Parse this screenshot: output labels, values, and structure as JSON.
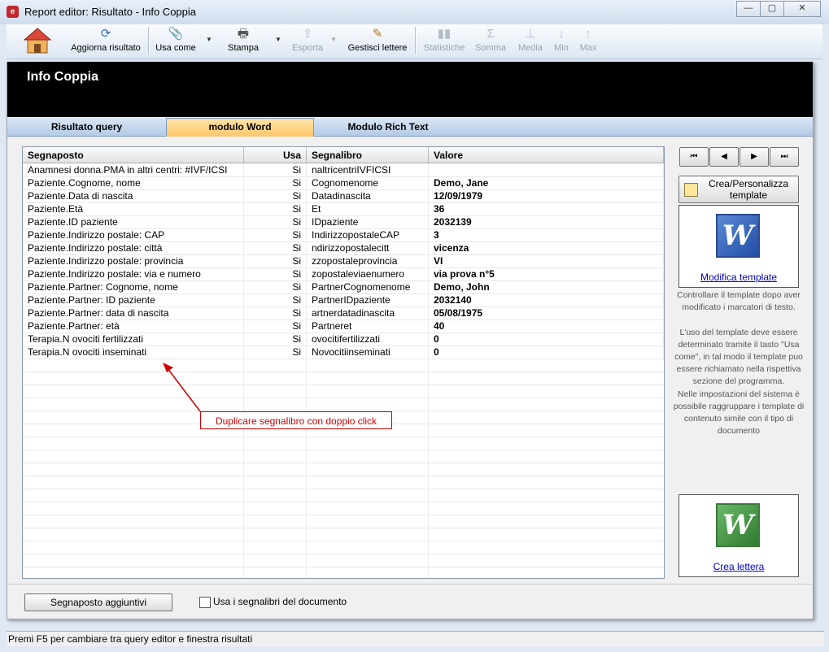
{
  "window": {
    "title": "Report editor: Risultato - Info Coppia",
    "min_glyph": "—",
    "max_glyph": "▢",
    "close_glyph": "✕"
  },
  "toolbar": {
    "items": [
      {
        "label": "Aggiorna risultato",
        "icon": "refresh-icon",
        "glyph": "⟳",
        "enabled": true
      },
      {
        "label": "Usa come",
        "icon": "clip-icon",
        "glyph": "📎",
        "enabled": true
      },
      {
        "label": "Stampa",
        "icon": "printer-icon",
        "glyph": "🖶",
        "enabled": true
      },
      {
        "label": "Esporta",
        "icon": "export-icon",
        "glyph": "⇪",
        "enabled": false
      },
      {
        "label": "Gestisci lettere",
        "icon": "letter-icon",
        "glyph": "✎",
        "enabled": true
      },
      {
        "label": "Statistiche",
        "icon": "chart-icon",
        "glyph": "▮▮",
        "enabled": false
      },
      {
        "label": "Somma",
        "icon": "sum-icon",
        "glyph": "Σ",
        "enabled": false
      },
      {
        "label": "Media",
        "icon": "average-icon",
        "glyph": "⊥",
        "enabled": false
      },
      {
        "label": "Min",
        "icon": "min-icon",
        "glyph": "↓",
        "enabled": false
      },
      {
        "label": "Max",
        "icon": "max-icon",
        "glyph": "↑",
        "enabled": false
      }
    ],
    "dropdown_glyph": "▼"
  },
  "header": {
    "title": "Info Coppia"
  },
  "tabs": [
    {
      "label": "Risultato query",
      "active": false
    },
    {
      "label": "modulo Word",
      "active": true
    },
    {
      "label": "Modulo Rich Text",
      "active": false
    }
  ],
  "table": {
    "columns": [
      "Segnaposto",
      "Usa",
      "Segnalibro",
      "Valore"
    ],
    "rows": [
      [
        "Anamnesi donna.PMA in altri centri: #IVF/ICSI",
        "Si",
        "naltricentriIVFICSI",
        ""
      ],
      [
        "Paziente.Cognome, nome",
        "Si",
        "Cognomenome",
        "Demo, Jane"
      ],
      [
        "Paziente.Data di nascita",
        "Si",
        "Datadinascita",
        "12/09/1979"
      ],
      [
        "Paziente.Età",
        "Si",
        "Et",
        "36"
      ],
      [
        "Paziente.ID paziente",
        "Si",
        "IDpaziente",
        "2032139"
      ],
      [
        "Paziente.Indirizzo postale: CAP",
        "Si",
        "IndirizzopostaleCAP",
        "3"
      ],
      [
        "Paziente.Indirizzo postale: città",
        "Si",
        "ndirizzopostalecitt",
        "vicenza"
      ],
      [
        "Paziente.Indirizzo postale: provincia",
        "Si",
        "zzopostaleprovincia",
        "VI"
      ],
      [
        "Paziente.Indirizzo postale: via e numero",
        "Si",
        "zopostaleviaenumero",
        "via prova n°5"
      ],
      [
        "Paziente.Partner: Cognome, nome",
        "Si",
        "PartnerCognomenome",
        "Demo, John"
      ],
      [
        "Paziente.Partner: ID paziente",
        "Si",
        "PartnerIDpaziente",
        "2032140"
      ],
      [
        "Paziente.Partner: data di nascita",
        "Si",
        "artnerdatadinascita",
        "05/08/1975"
      ],
      [
        "Paziente.Partner: età",
        "Si",
        "Partneret",
        "40"
      ],
      [
        "Terapia.N ovociti fertilizzati",
        "Si",
        "ovocitifertilizzati",
        "0"
      ],
      [
        "Terapia.N ovociti inseminati",
        "Si",
        "Novocitiinseminati",
        "0"
      ]
    ]
  },
  "callout": {
    "text": "Duplicare segnalibro con doppio click"
  },
  "nav": {
    "first": "⏮",
    "prev": "◀",
    "next": "▶",
    "last": "⏭"
  },
  "side": {
    "crea_button": "Crea/Personalizza template",
    "modifica_link": "Modifica template",
    "crea_lettera_link": "Crea lettera",
    "word_glyph": "W",
    "info_text": "Controllare il template dopo aver modificato i marcatori di testo.\n\nL'uso del template deve essere determinato tramite il tasto \"Usa come\", in tal modo il template puo essere richiamato nella rispettiva sezione del programma.\nNelle impostazioni del sistema è possibile raggruppare i template di contenuto simile con il tipo di documento"
  },
  "bottom": {
    "segnaposto_button": "Segnaposto aggiuntivi",
    "checkbox_label": "Usa i segnalibri del documento"
  },
  "statusbar": {
    "text": "Premi F5 per cambiare tra query editor e finestra risultati"
  }
}
